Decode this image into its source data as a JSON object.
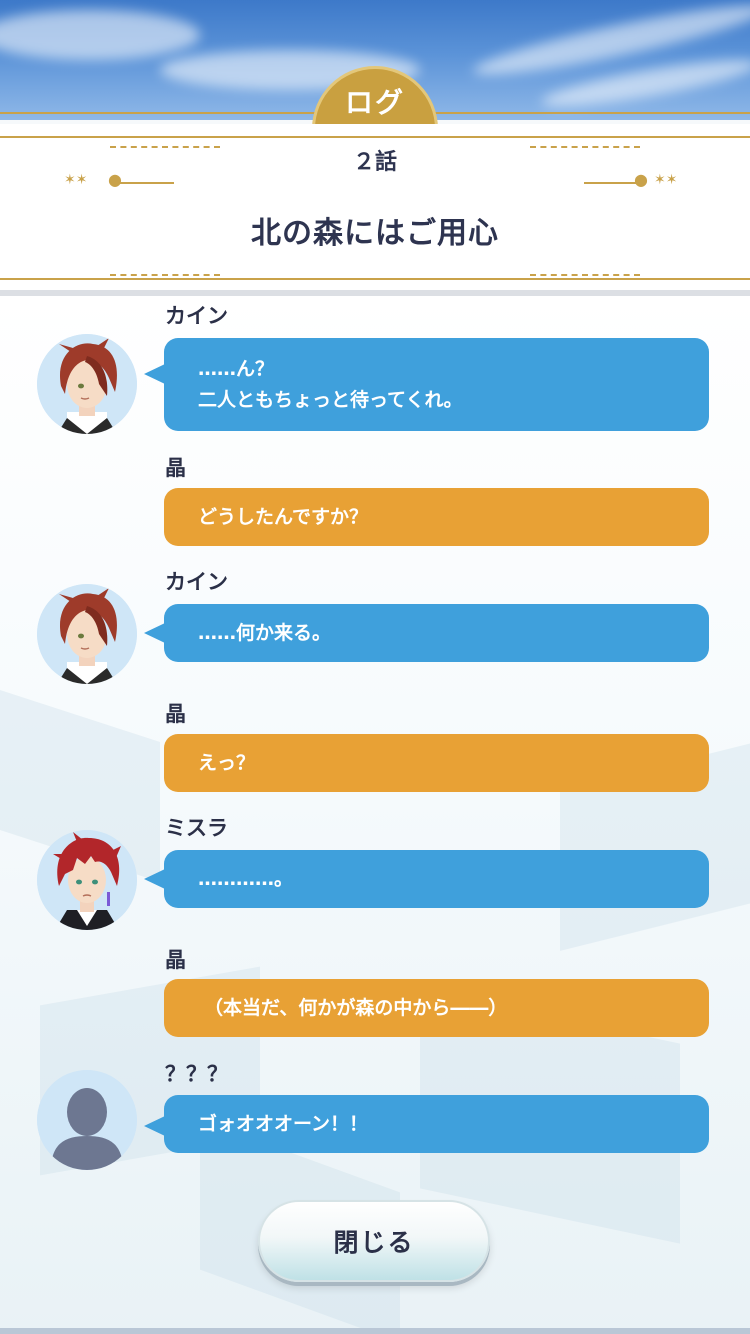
{
  "header": {
    "tab_label": "ログ"
  },
  "episode": {
    "number": "２話",
    "title": "北の森にはご用心"
  },
  "log": [
    {
      "speaker": "カイン",
      "lines": [
        "……ん？",
        "二人ともちょっと待ってくれ。"
      ],
      "color": "#3fa0dc",
      "avatar": "kain-portrait"
    },
    {
      "speaker": "晶",
      "lines": [
        "どうしたんですか？"
      ],
      "color": "#e8a135",
      "avatar": null
    },
    {
      "speaker": "カイン",
      "lines": [
        "……何か来る。"
      ],
      "color": "#3fa0dc",
      "avatar": "kain-portrait"
    },
    {
      "speaker": "晶",
      "lines": [
        "えっ？"
      ],
      "color": "#e8a135",
      "avatar": null
    },
    {
      "speaker": "ミスラ",
      "lines": [
        "…………。"
      ],
      "color": "#3fa0dc",
      "avatar": "mithra-portrait"
    },
    {
      "speaker": "晶",
      "lines": [
        "（本当だ、何かが森の中から――）"
      ],
      "color": "#e8a135",
      "avatar": null
    },
    {
      "speaker": "？？？",
      "lines": [
        "ゴォオオオーン！！"
      ],
      "color": "#3fa0dc",
      "avatar": "unknown-silhouette"
    }
  ],
  "footer": {
    "close_label": "閉じる"
  },
  "colors": {
    "gold": "#c9a24a",
    "speech_blue": "#3fa0dc",
    "speech_orange": "#e8a135",
    "text_dark": "#2b3048"
  }
}
